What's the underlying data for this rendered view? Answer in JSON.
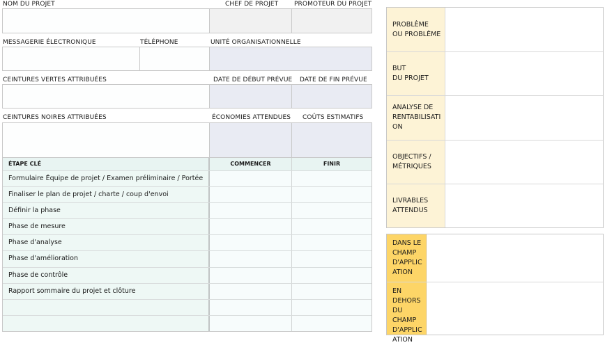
{
  "header": {
    "project_name": "NOM DU PROJET",
    "project_manager": "CHEF DE PROJET",
    "sponsor": "PROMOTEUR DU PROJET",
    "email": "MESSAGERIE ÉLECTRONIQUE",
    "phone": "TÉLÉPHONE",
    "org_unit": "UNITÉ ORGANISATIONNELLE",
    "green_belts": "CEINTURES VERTES ATTRIBUÉES",
    "start_date": "DATE DE DÉBUT PRÉVUE",
    "end_date": "DATE DE FIN PRÉVUE",
    "black_belts": "CEINTURES NOIRES ATTRIBUÉES",
    "savings": "ÉCONOMIES ATTENDUES",
    "costs": "COÛTS ESTIMATIFS"
  },
  "milestones": {
    "col_step": "ÉTAPE CLÉ",
    "col_start": "COMMENCER",
    "col_end": "FINIR",
    "rows": [
      "Formulaire Équipe de projet / Examen préliminaire / Portée",
      "Finaliser le plan de projet / charte / coup d'envoi",
      "Définir la phase",
      "Phase de mesure",
      "Phase d'analyse",
      "Phase d'amélioration",
      "Phase de contrôle",
      "Rapport sommaire du projet et clôture",
      "",
      ""
    ]
  },
  "details": {
    "problem": "PROBLÈME\nOU PROBLÈME",
    "purpose": "BUT\nDU PROJET",
    "business_case": "ANALYSE DE\nRENTABILISATI\nON",
    "goals": "OBJECTIFS /\nMÉTRIQUES",
    "deliverables": "LIVRABLES\nATTENDUS"
  },
  "scope": {
    "in_scope": "DANS LE\nCHAMP\nD'APPLIC\nATION",
    "out_scope": "EN\nDEHORS\nDU\nCHAMP\nD'APPLIC\nATION"
  }
}
